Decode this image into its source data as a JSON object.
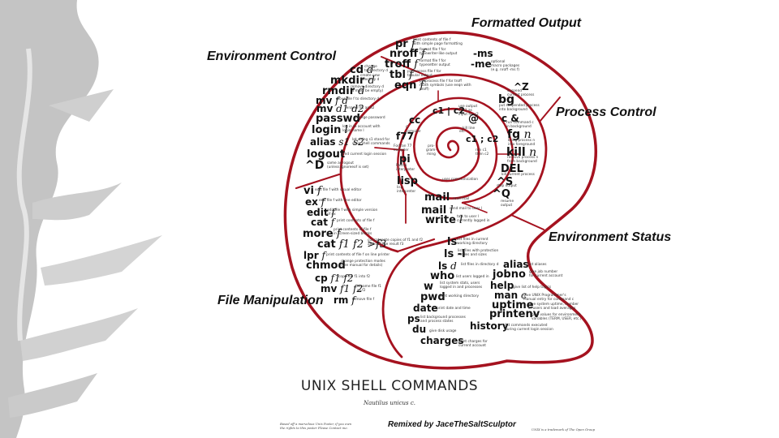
{
  "categories": {
    "formatted_output": "Formatted Output",
    "environment_control": "Environment Control",
    "process_control": "Process Control",
    "environment_status": "Environment Status",
    "file_manipulation": "File Manipulation"
  },
  "commands": [
    {
      "id": "pr",
      "cmd": "pr",
      "arg": "f",
      "desc": "print contents of file f\nwith simple page formatting"
    },
    {
      "id": "nroff",
      "cmd": "nroff",
      "arg": "f",
      "desc": "format file f for\ntypewriter-like output"
    },
    {
      "id": "troff",
      "cmd": "troff",
      "arg": "f",
      "desc": "format file f for\ntypesetter output"
    },
    {
      "id": "tbl",
      "cmd": "tbl",
      "arg": "f",
      "desc": "preprocess file f for\ntabular output"
    },
    {
      "id": "eqn",
      "cmd": "eqn",
      "arg": "f",
      "desc": "preprocess file f for troff\nmath symbols (use eeqn with\nnroff)"
    },
    {
      "id": "ms",
      "cmd": "-ms",
      "arg": "",
      "desc": ""
    },
    {
      "id": "me",
      "cmd": "-me",
      "arg": "",
      "desc": "optional\nmacro packages\n(e.g. nroff -ms f)"
    },
    {
      "id": "cd",
      "cmd": "cd",
      "arg": "d",
      "desc": "change\nto directory d"
    },
    {
      "id": "mkdir",
      "cmd": "mkdir",
      "arg": "d",
      "desc": "create new\ndirectory d"
    },
    {
      "id": "rmdir",
      "cmd": "rmdir",
      "arg": "d",
      "desc": "remove directory d\n(d must be empty)"
    },
    {
      "id": "mv_dir",
      "cmd": "mv",
      "arg": "f d",
      "desc": "move file f to directory d"
    },
    {
      "id": "mv_rename_dir",
      "cmd": "mv",
      "arg": "d1 d2",
      "desc": "rename d1 as d2"
    },
    {
      "id": "passwd",
      "cmd": "passwd",
      "arg": "",
      "desc": "change password"
    },
    {
      "id": "login",
      "cmd": "login",
      "arg": "l",
      "desc": "log in to account with\nlogin name l"
    },
    {
      "id": "alias_set",
      "cmd": "alias",
      "arg": "s1 s2",
      "desc": "let string s1 stand for\ns2 in shell commands"
    },
    {
      "id": "logout",
      "cmd": "logout",
      "arg": "",
      "desc": "end current login session"
    },
    {
      "id": "ctrl_d",
      "cmd": "^D",
      "arg": "",
      "desc": "same as logout\n(unless ignoreeof is set)"
    },
    {
      "id": "ctrl_z",
      "cmd": "^Z",
      "arg": "",
      "desc": "suspend\ncurrent process"
    },
    {
      "id": "bg",
      "cmd": "bg",
      "arg": "",
      "desc": "put suspended process\ninto background"
    },
    {
      "id": "amp",
      "cmd": "c &",
      "arg": "",
      "desc": "run command c\nin background"
    },
    {
      "id": "fg",
      "cmd": "fg",
      "arg": "n",
      "desc": "bring process n\ninto foreground"
    },
    {
      "id": "kill",
      "cmd": "kill",
      "arg": "n",
      "desc": "remove process n\nfrom background"
    },
    {
      "id": "del",
      "cmd": "DEL",
      "arg": "",
      "desc": "kill current process"
    },
    {
      "id": "ctrl_s",
      "cmd": "^S",
      "arg": "",
      "desc": "stop output"
    },
    {
      "id": "ctrl_q",
      "cmd": "^Q",
      "arg": "",
      "desc": "resume\noutput"
    },
    {
      "id": "pipe",
      "cmd": "c1 | c2",
      "arg": "",
      "desc": "use output\nof c1 as\ninput for c2"
    },
    {
      "id": "cc",
      "cmd": "cc",
      "arg": "",
      "desc": "C\ncompiler"
    },
    {
      "id": "at",
      "cmd": "@",
      "arg": "",
      "desc": "kill line"
    },
    {
      "id": "seq",
      "cmd": "c1 ; c2",
      "arg": "",
      "desc": "run c1\nthen c2"
    },
    {
      "id": "f77",
      "cmd": "f77",
      "arg": "",
      "desc": "Fortran 77\ncompiler"
    },
    {
      "id": "pi",
      "cmd": "pi",
      "arg": "",
      "desc": "Pascal\ninterpreter"
    },
    {
      "id": "lisp",
      "cmd": "lisp",
      "arg": "",
      "desc": "lisp\ninterpreter"
    },
    {
      "id": "mail",
      "cmd": "mail",
      "arg": "",
      "desc": "read mail"
    },
    {
      "id": "mail_l",
      "cmd": "mail",
      "arg": "l",
      "desc": "send mail to user l"
    },
    {
      "id": "write",
      "cmd": "write",
      "arg": "l",
      "desc": "talk to user l\ncurrently logged in"
    },
    {
      "id": "vi",
      "cmd": "vi",
      "arg": "f",
      "desc": "edit file f with visual editor"
    },
    {
      "id": "ex",
      "cmd": "ex",
      "arg": "f",
      "desc": "edit file f with line editor"
    },
    {
      "id": "edit",
      "cmd": "edit",
      "arg": "f",
      "desc": "edit file f with simple version\nof ex"
    },
    {
      "id": "cat",
      "cmd": "cat",
      "arg": "f",
      "desc": "print contents of file f"
    },
    {
      "id": "more",
      "cmd": "more",
      "arg": "f",
      "desc": "print contents of file f\nin screen-sized blocks"
    },
    {
      "id": "cat_concat",
      "cmd": "cat",
      "arg": "f1 f2 >f3",
      "desc": "concatenate copies of f1 and f2\nand call the result f3"
    },
    {
      "id": "lpr",
      "cmd": "lpr",
      "arg": "f",
      "desc": "print contents of file f on line printer"
    },
    {
      "id": "chmod",
      "cmd": "chmod",
      "arg": "",
      "desc": "change protection modes\n(see manual for details)"
    },
    {
      "id": "cp",
      "cmd": "cp",
      "arg": "f1 f2",
      "desc": "copy file f1 into f2"
    },
    {
      "id": "mv_rename",
      "cmd": "mv",
      "arg": "f1 f2",
      "desc": "rename file f1\nas f2"
    },
    {
      "id": "rm",
      "cmd": "rm",
      "arg": "f",
      "desc": "remove file f"
    },
    {
      "id": "ls",
      "cmd": "ls",
      "arg": "",
      "desc": "list files in current\nworking directory"
    },
    {
      "id": "ls_l",
      "cmd": "ls -l",
      "arg": "",
      "desc": "list files with protection\nmodes and sizes"
    },
    {
      "id": "ls_d",
      "cmd": "ls",
      "arg": "d",
      "desc": "list files in directory d"
    },
    {
      "id": "who",
      "cmd": "who",
      "arg": "",
      "desc": "list users logged in"
    },
    {
      "id": "w",
      "cmd": "w",
      "arg": "",
      "desc": "list system stats, users\nlogged in and processes"
    },
    {
      "id": "pwd",
      "cmd": "pwd",
      "arg": "",
      "desc": "print working directory"
    },
    {
      "id": "date",
      "cmd": "date",
      "arg": "",
      "desc": "print date and time"
    },
    {
      "id": "ps",
      "cmd": "ps",
      "arg": "",
      "desc": "list background processes\nand process states"
    },
    {
      "id": "du",
      "cmd": "du",
      "arg": "",
      "desc": "give disk usage"
    },
    {
      "id": "charges",
      "cmd": "charges",
      "arg": "",
      "desc": "print charges for\ncurrent account"
    },
    {
      "id": "alias",
      "cmd": "alias",
      "arg": "",
      "desc": "list aliases"
    },
    {
      "id": "jobno",
      "cmd": "jobno",
      "arg": "",
      "desc": "give job number\nfor current account"
    },
    {
      "id": "help",
      "cmd": "help",
      "arg": "",
      "desc": "give list of help topics"
    },
    {
      "id": "man",
      "cmd": "man",
      "arg": "c",
      "desc": "give UNIX Programmer's\nManual entry for command c"
    },
    {
      "id": "uptime",
      "cmd": "uptime",
      "arg": "",
      "desc": "give system uptime, number\nof users and load averages"
    },
    {
      "id": "printenv",
      "cmd": "printenv",
      "arg": "",
      "desc": "give values for environment\nvariables (TERM, USER, etc.)"
    },
    {
      "id": "history",
      "cmd": "history",
      "arg": "",
      "desc": "list commands executed\nduring current login session"
    }
  ],
  "center_labels": {
    "pro_gram_ming": "pro-\ngram-\nming",
    "etc": "etc",
    "user_communication": "user communication"
  },
  "title": "UNIX SHELL COMMANDS",
  "subtitle": "Nautilus unicus c.",
  "credit": "Remixed by JaceTheSaltSculptor",
  "footnote_left": "Based off a marvelous Unix Poster, if you own\nthe rights to this poster Please Contact me.",
  "footnote_right": "UNIX is a trademark of The Open Group",
  "colors": {
    "shell_stroke": "#a5121f",
    "brush": "#bdbdbd",
    "text": "#111111"
  }
}
